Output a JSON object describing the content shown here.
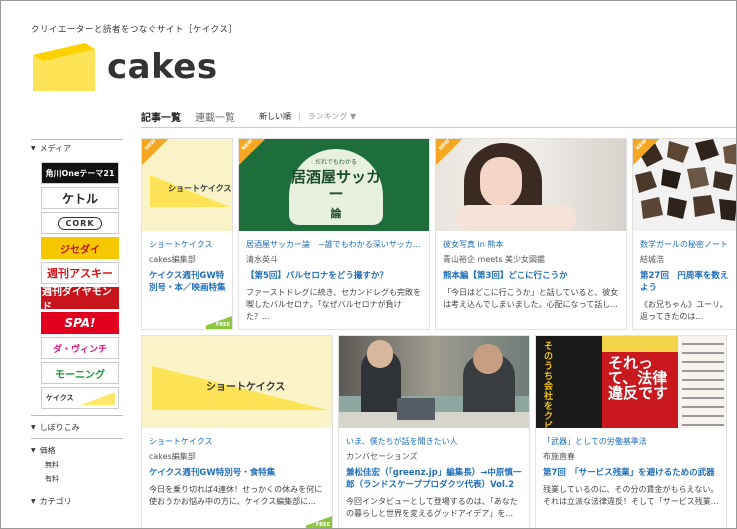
{
  "header": {
    "tagline": "クリイエーターと読者をつなぐサイト［ケイクス］",
    "logo_text": "cakes"
  },
  "tabs": {
    "articles": "記事一覧",
    "series": "連載一覧",
    "sort_new": "新しい順",
    "sort_sep": "|",
    "ranking": "ランキング ▼"
  },
  "sidebar": {
    "media_heading": "メディア",
    "media": [
      {
        "label": "角川Oneテーマ21"
      },
      {
        "label": "ケトル"
      },
      {
        "label": "CORK"
      },
      {
        "label": "ジセダイ"
      },
      {
        "label": "週刊アスキー"
      },
      {
        "label": "週刊ダイヤモンド"
      },
      {
        "label": "SPA!"
      },
      {
        "label": "ダ・ヴィンチ"
      },
      {
        "label": "モーニング"
      },
      {
        "label": "ケイクス"
      }
    ],
    "filter_heading": "しぼりこみ",
    "price_heading": "価格",
    "price_free": "無料",
    "price_paid": "有料",
    "category_heading": "カテゴリ"
  },
  "cards": [
    {
      "image_label": "ショートケイクス",
      "category": "ショートケイクス",
      "author": "cakes編集部",
      "title": "ケイクス週刊GW特別号・本／映画特集",
      "desc": "",
      "new_tag": "NEW",
      "free_tag": "FREE"
    },
    {
      "image_small": "だれでもわかる",
      "image_big": "居酒屋サッカー",
      "image_ron": "論",
      "category": "居酒屋サッカー論　~誰でもわかる深いサッカ...",
      "author": "清水英斗",
      "title": "【第5回】バルセロナをどう撮すか？",
      "desc": "ファーストドレグに続き、セカンドレグも完敗を喫したバルセロナ。「なぜバルセロナが負けた？...",
      "new_tag": "NEW"
    },
    {
      "category": "彼女写真 in 熊本",
      "author": "青山裕企 meets 美少女図鑑",
      "title": "熊本編【第3回】どこに行こうか",
      "desc": "「今日はどこに行こうか」と話していると、彼女は考え込んでしまいました。心配になって話し...",
      "new_tag": "NEW"
    },
    {
      "category": "数学ガールの秘密ノート",
      "author": "結城浩",
      "title": "第27回　円周率を数えよう",
      "desc": "《お兄ちゃん》ユーリ。返ってきたのは...",
      "new_tag": "NEW"
    },
    {
      "image_label": "ショートケイクス",
      "category": "ショートケイクス",
      "author": "cakes編集部",
      "title": "ケイクス週刊GW特別号・食特集",
      "desc": "今日を乗り切れば4連休！せっかくの休みを何に使おうかお悩み中の方に、ケイクス編集部に...",
      "free_tag": "FREE"
    },
    {
      "category": "いま、僕たちが話を聞きたい人",
      "author": "カンバセーションズ",
      "title": "兼松佳宏（「greenz.jp」編集長）→中原慎一郎（ランドスケーププロダクツ代表）Vol.2",
      "desc": "今回インタビューとして登場するのは、「あなたの暮らしと世界を変えるグッドアイデア」を..."
    },
    {
      "book1_text": "そのうち会社をクビになる",
      "book2_text": "それって、法律違反です",
      "category": "「武器」としての労働基準法",
      "author": "布施直春",
      "title": "第7回　「サービス残業」を避けるための武器",
      "desc": "残業しているのに、その分の賃金がもらえない。それは立派な法律違反！そして「サービス残業..."
    }
  ]
}
